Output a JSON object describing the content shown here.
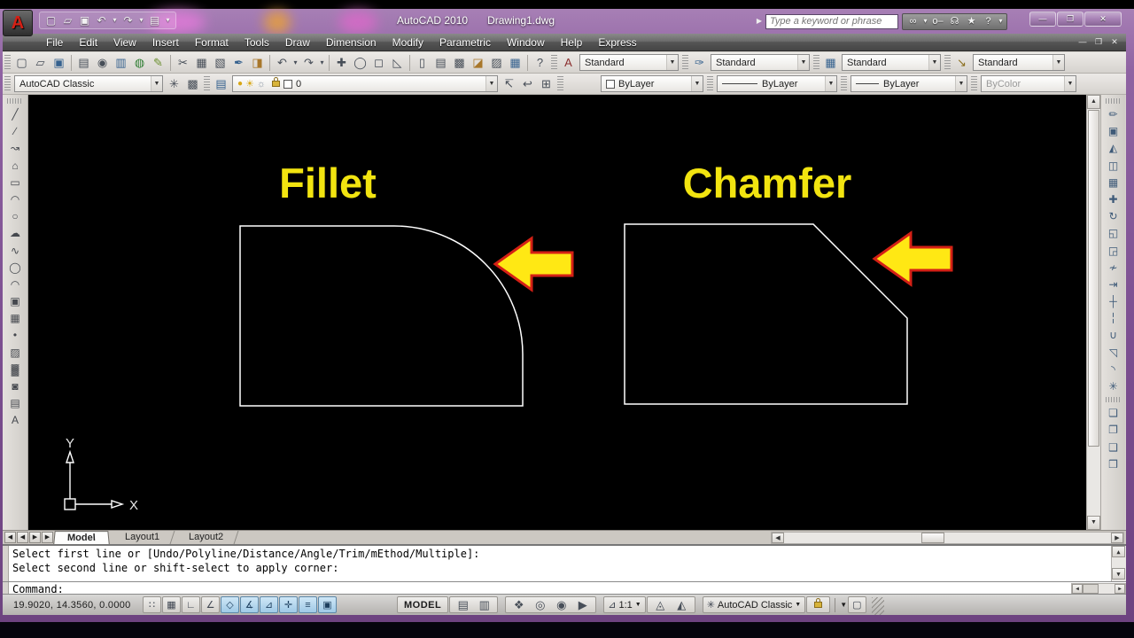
{
  "window": {
    "app_title": "AutoCAD 2010",
    "doc_title": "Drawing1.dwg"
  },
  "infocenter": {
    "search_placeholder": "Type a keyword or phrase"
  },
  "menus": {
    "items": [
      "File",
      "Edit",
      "View",
      "Insert",
      "Format",
      "Tools",
      "Draw",
      "Dimension",
      "Modify",
      "Parametric",
      "Window",
      "Help",
      "Express"
    ]
  },
  "window_controls": {
    "minimize": "—",
    "maximize": "❐",
    "close": "✕"
  },
  "doc_controls": {
    "minimize": "—",
    "restore": "❐",
    "close": "✕"
  },
  "styles_toolbar": {
    "text_style": "Standard",
    "dim_style": "Standard",
    "table_style": "Standard",
    "mleader_style": "Standard"
  },
  "workspace_bar": {
    "workspace": "AutoCAD Classic"
  },
  "layer_bar": {
    "current_layer": "0"
  },
  "properties_bar": {
    "color": "ByLayer",
    "linetype": "ByLayer",
    "lineweight": "ByLayer",
    "plot_style": "ByColor"
  },
  "canvas": {
    "fillet_label": "Fillet",
    "chamfer_label": "Chamfer",
    "ucs_x": "X",
    "ucs_y": "Y",
    "line_color": "#ffffff",
    "label_color": "#f2e410",
    "arrow_fill": "#ffe814",
    "arrow_stroke": "#d42015"
  },
  "tabs": {
    "model": "Model",
    "layout1": "Layout1",
    "layout2": "Layout2"
  },
  "command_window": {
    "history": [
      "Select first line or [Undo/Polyline/Distance/Angle/Trim/mEthod/Multiple]:",
      "Select second line or shift-select to apply corner:"
    ],
    "prompt": "Command:"
  },
  "status_bar": {
    "coordinates": "19.9020, 14.3560, 0.0000",
    "model_button": "MODEL",
    "annotation_scale": "1:1",
    "workspace_switcher": "AutoCAD Classic"
  },
  "icons": {
    "quick_access": [
      {
        "n": "qat-new-icon",
        "g": "▢"
      },
      {
        "n": "qat-open-icon",
        "g": "▱"
      },
      {
        "n": "qat-save-icon",
        "g": "▣"
      },
      {
        "n": "qat-undo-icon",
        "g": "↶"
      },
      {
        "n": "qat-undo-dropdown-icon",
        "g": "▾",
        "sm": 1
      },
      {
        "n": "qat-redo-icon",
        "g": "↷"
      },
      {
        "n": "qat-redo-dropdown-icon",
        "g": "▾",
        "sm": 1
      },
      {
        "n": "qat-plot-icon",
        "g": "▤"
      },
      {
        "n": "qat-customize-dropdown-icon",
        "g": "▾",
        "sm": 1
      }
    ],
    "infocenter_btns": [
      {
        "n": "search-binoculars-icon",
        "g": "∞"
      },
      {
        "n": "binoculars-dropdown-icon",
        "g": "▾",
        "sm": 1
      },
      {
        "n": "subscription-key-icon",
        "g": "o–"
      },
      {
        "n": "communication-center-icon",
        "g": "☊"
      },
      {
        "n": "favorites-star-icon",
        "g": "★"
      },
      {
        "n": "help-question-icon",
        "g": "?"
      },
      {
        "n": "help-dropdown-icon",
        "g": "▾",
        "sm": 1
      }
    ],
    "standard_toolbar": [
      {
        "n": "new-icon",
        "g": "▢"
      },
      {
        "n": "open-icon",
        "g": "▱"
      },
      {
        "n": "save-icon",
        "g": "▣",
        "c": "#35618e"
      },
      {
        "sep": true
      },
      {
        "n": "plot-icon",
        "g": "▤"
      },
      {
        "n": "plot-preview-icon",
        "g": "◉"
      },
      {
        "n": "publish-icon",
        "g": "▥",
        "c": "#35618e"
      },
      {
        "n": "web-publish-icon",
        "g": "◍",
        "c": "#2e7d32"
      },
      {
        "n": "markup-icon",
        "g": "✎",
        "c": "#6a8f2f"
      },
      {
        "sep": true
      },
      {
        "n": "cut-icon",
        "g": "✂"
      },
      {
        "n": "copy-clip-icon",
        "g": "▦"
      },
      {
        "n": "paste-icon",
        "g": "▧"
      },
      {
        "n": "match-properties-icon",
        "g": "✒",
        "c": "#35618e"
      },
      {
        "n": "block-editor-icon",
        "g": "◨",
        "c": "#a8772b"
      },
      {
        "sep": true
      },
      {
        "n": "undo-icon",
        "g": "↶"
      },
      {
        "n": "undo-dropdown-icon",
        "g": "▾",
        "sm": 1
      },
      {
        "n": "redo-icon",
        "g": "↷"
      },
      {
        "n": "redo-dropdown-icon",
        "g": "▾",
        "sm": 1
      },
      {
        "sep": true
      },
      {
        "n": "pan-realtime-icon",
        "g": "✚"
      },
      {
        "n": "zoom-realtime-icon",
        "g": "◯"
      },
      {
        "n": "zoom-window-icon",
        "g": "◻"
      },
      {
        "n": "zoom-previous-icon",
        "g": "◺"
      },
      {
        "sep": true
      },
      {
        "n": "properties-palette-icon",
        "g": "▯"
      },
      {
        "n": "designcenter-icon",
        "g": "▤"
      },
      {
        "n": "tool-palettes-icon",
        "g": "▩"
      },
      {
        "n": "sheet-set-manager-icon",
        "g": "◪",
        "c": "#a8772b"
      },
      {
        "n": "markup-set-manager-icon",
        "g": "▨"
      },
      {
        "n": "quickcalc-icon",
        "g": "▦",
        "c": "#35618e"
      },
      {
        "sep": true
      },
      {
        "n": "help-icon",
        "g": "?"
      }
    ],
    "style_icons": [
      {
        "n": "text-style-icon",
        "g": "A",
        "c": "#8a2d2d"
      },
      {
        "n": "dim-style-icon",
        "g": "✑",
        "c": "#35618e"
      },
      {
        "n": "table-style-icon",
        "g": "▦",
        "c": "#35618e"
      },
      {
        "n": "mleader-style-icon",
        "g": "↘",
        "c": "#8a6d1c"
      }
    ],
    "workspace_btns": [
      {
        "n": "workspace-settings-gear-icon",
        "g": "✳"
      },
      {
        "n": "my-workspace-icon",
        "g": "▩"
      }
    ],
    "layer_btns_left": [
      {
        "n": "layer-properties-manager-icon",
        "g": "▤",
        "c": "#35618e"
      }
    ],
    "layer_btns_right": [
      {
        "n": "make-object-layer-current-icon",
        "g": "↸"
      },
      {
        "n": "layer-previous-icon",
        "g": "↩"
      },
      {
        "n": "layer-states-manager-icon",
        "g": "⊞"
      }
    ],
    "draw_toolbar": [
      {
        "n": "line-icon",
        "g": "╱"
      },
      {
        "n": "construction-line-icon",
        "g": "∕"
      },
      {
        "n": "polyline-icon",
        "g": "↝"
      },
      {
        "n": "polygon-icon",
        "g": "⌂"
      },
      {
        "n": "rectangle-icon",
        "g": "▭"
      },
      {
        "n": "arc-icon",
        "g": "◠"
      },
      {
        "n": "circle-icon",
        "g": "○"
      },
      {
        "n": "revision-cloud-icon",
        "g": "☁"
      },
      {
        "n": "spline-icon",
        "g": "∿"
      },
      {
        "n": "ellipse-icon",
        "g": "◯"
      },
      {
        "n": "ellipse-arc-icon",
        "g": "◠"
      },
      {
        "n": "insert-block-icon",
        "g": "▣"
      },
      {
        "n": "make-block-icon",
        "g": "▦"
      },
      {
        "n": "point-icon",
        "g": "•"
      },
      {
        "n": "hatch-icon",
        "g": "▨"
      },
      {
        "n": "gradient-icon",
        "g": "▓"
      },
      {
        "n": "region-icon",
        "g": "◙"
      },
      {
        "n": "table-icon",
        "g": "▤"
      },
      {
        "n": "mtext-icon",
        "g": "A"
      }
    ],
    "modify_toolbar": [
      {
        "n": "erase-icon",
        "g": "✏"
      },
      {
        "n": "copy-icon",
        "g": "▣"
      },
      {
        "n": "mirror-icon",
        "g": "◭"
      },
      {
        "n": "offset-icon",
        "g": "◫"
      },
      {
        "n": "array-icon",
        "g": "▦"
      },
      {
        "n": "move-icon",
        "g": "✚"
      },
      {
        "n": "rotate-icon",
        "g": "↻"
      },
      {
        "n": "scale-icon",
        "g": "◱"
      },
      {
        "n": "stretch-icon",
        "g": "◲"
      },
      {
        "n": "trim-icon",
        "g": "≁"
      },
      {
        "n": "extend-icon",
        "g": "⇥"
      },
      {
        "n": "break-at-point-icon",
        "g": "┼"
      },
      {
        "n": "break-icon",
        "g": "╎"
      },
      {
        "n": "join-icon",
        "g": "∪"
      },
      {
        "n": "chamfer-icon",
        "g": "◹"
      },
      {
        "n": "fillet-icon",
        "g": "◝"
      },
      {
        "n": "explode-icon",
        "g": "✳"
      }
    ],
    "draworder_toolbar": [
      {
        "n": "bring-to-front-icon",
        "g": "❏"
      },
      {
        "n": "send-to-back-icon",
        "g": "❐"
      },
      {
        "n": "bring-above-objects-icon",
        "g": "❑"
      },
      {
        "n": "send-under-objects-icon",
        "g": "❒"
      }
    ],
    "tab_nav": [
      {
        "n": "first-tab-icon",
        "g": "◀"
      },
      {
        "n": "prev-tab-icon",
        "g": "◀"
      },
      {
        "n": "next-tab-icon",
        "g": "▶"
      },
      {
        "n": "last-tab-icon",
        "g": "▶"
      }
    ],
    "status_toggles": [
      {
        "n": "snap-toggle",
        "g": "∷"
      },
      {
        "n": "grid-toggle",
        "g": "▦"
      },
      {
        "n": "ortho-toggle",
        "g": "∟"
      },
      {
        "n": "polar-toggle",
        "g": "∠"
      },
      {
        "n": "osnap-toggle",
        "g": "◇",
        "on": true
      },
      {
        "n": "otrack-toggle",
        "g": "∡",
        "on": true
      },
      {
        "n": "ducs-toggle",
        "g": "⊿",
        "on": true
      },
      {
        "n": "dyn-toggle",
        "g": "✛",
        "on": true
      },
      {
        "n": "lwt-toggle",
        "g": "≡",
        "on": true
      },
      {
        "n": "qp-toggle",
        "g": "▣",
        "on": true
      }
    ],
    "status_space": [
      {
        "n": "model-space-icon",
        "g": "▤"
      },
      {
        "n": "layout-space-icon",
        "g": "▥"
      }
    ],
    "status_nav": [
      {
        "n": "pan-hand-icon",
        "g": "❖"
      },
      {
        "n": "zoom-status-icon",
        "g": "◎"
      },
      {
        "n": "steering-wheel-icon",
        "g": "◉"
      },
      {
        "n": "showmotion-icon",
        "g": "▶"
      }
    ],
    "status_annot": [
      {
        "n": "annotation-visibility-icon",
        "g": "◬"
      },
      {
        "n": "annotation-autoscale-icon",
        "g": "◭"
      }
    ]
  }
}
